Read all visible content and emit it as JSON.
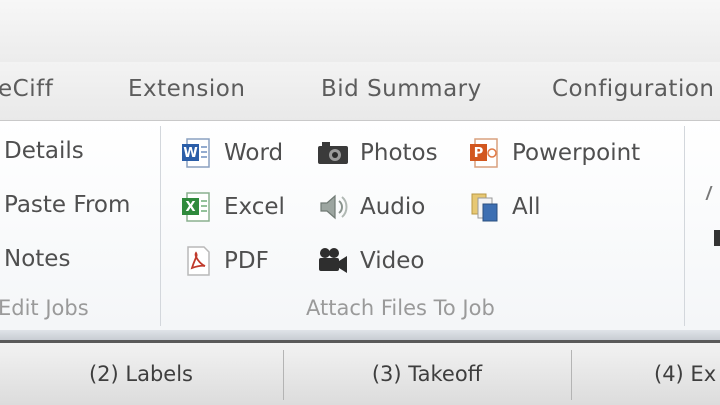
{
  "tabs": [
    "eCiff",
    "Extension",
    "Bid Summary",
    "Configuration"
  ],
  "edit_jobs": {
    "items": [
      "Details",
      "Paste From",
      "Notes"
    ],
    "group_label": "Edit Jobs"
  },
  "attach_files": {
    "items": [
      "Word",
      "Excel",
      "PDF",
      "Photos",
      "Audio",
      "Video",
      "Powerpoint",
      "All"
    ],
    "group_label": "Attach Files To Job"
  },
  "bottom_tabs": [
    "(2) Labels",
    "(3) Takeoff",
    "(4) Ex"
  ],
  "icons": {
    "word": "word-doc-icon",
    "excel": "excel-doc-icon",
    "pdf": "pdf-doc-icon",
    "photos": "camera-icon",
    "audio": "speaker-icon",
    "video": "video-camera-icon",
    "powerpoint": "powerpoint-doc-icon",
    "all": "all-files-icon"
  },
  "colors": {
    "word": "#2b5ea8",
    "excel": "#2f8a3c",
    "pdf": "#c0392b",
    "powerpoint": "#d2571f"
  }
}
